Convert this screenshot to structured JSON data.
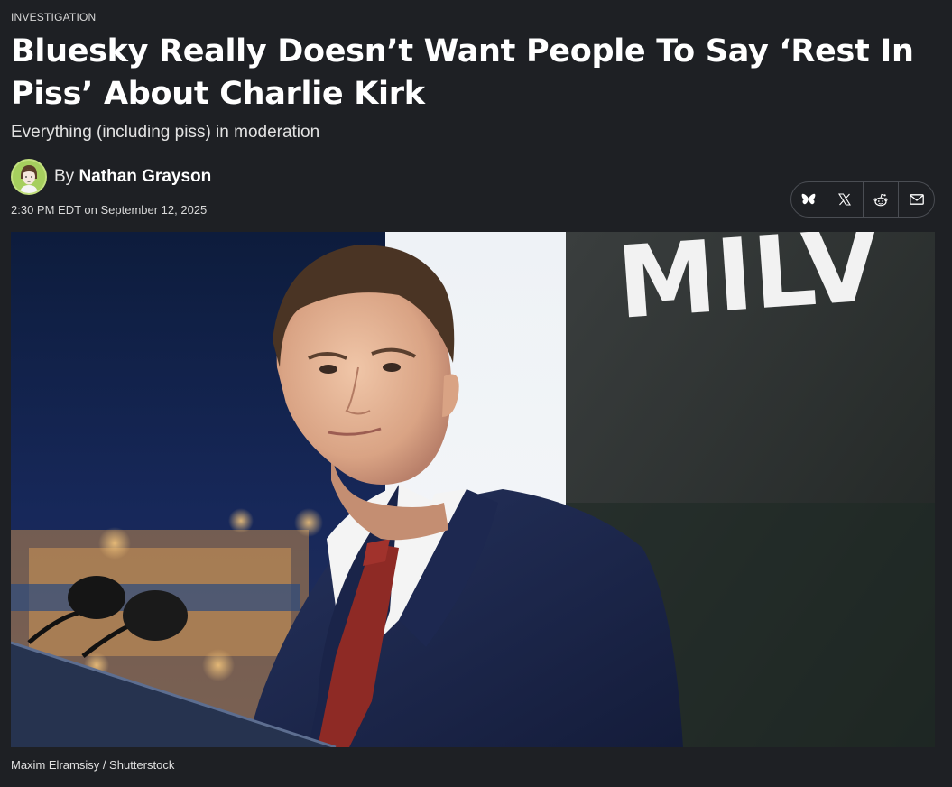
{
  "article": {
    "category": "INVESTIGATION",
    "headline": "Bluesky Really Doesn’t Want People To Say ‘Rest In Piss’ About Charlie Kirk",
    "subhead": "Everything (including piss) in moderation",
    "byline_prefix": "By",
    "author": "Nathan Grayson",
    "timestamp": "2:30 PM EDT on September 12, 2025",
    "image_caption": "Maxim Elramsisy / Shutterstock",
    "image_sign_text": "MILV"
  },
  "share": {
    "buttons": [
      {
        "name": "bluesky",
        "icon": "butterfly-icon"
      },
      {
        "name": "x",
        "icon": "x-logo-icon"
      },
      {
        "name": "reddit",
        "icon": "reddit-icon"
      },
      {
        "name": "email",
        "icon": "envelope-icon"
      }
    ]
  },
  "colors": {
    "background": "#1e2024",
    "headline": "#ffffff",
    "avatar_bg": "#a6cf5e",
    "suit": "#1b2547",
    "tie": "#8e2a25"
  }
}
